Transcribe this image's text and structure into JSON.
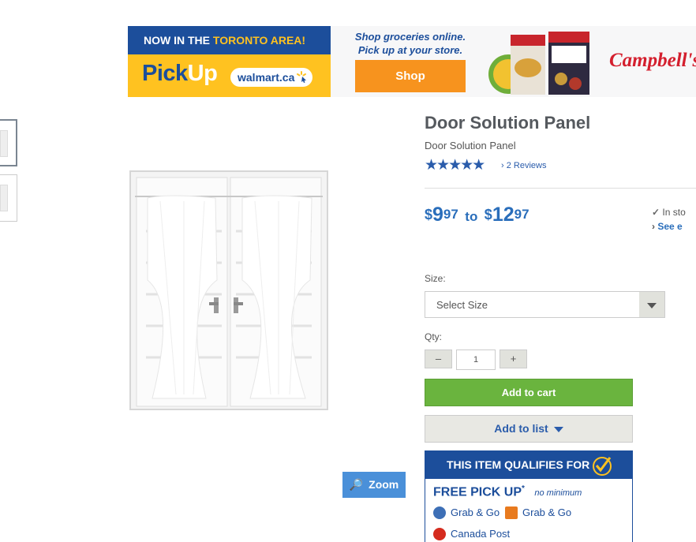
{
  "banner": {
    "headline_prefix": "NOW IN THE",
    "headline_highlight": "TORONTO AREA!",
    "pickup_part1": "Pick",
    "pickup_part2": "Up",
    "walmart_domain": "walmart.ca",
    "message_line1": "Shop groceries online.",
    "message_line2": "Pick up at your store.",
    "shop_button": "Shop",
    "brand": "Campbell's."
  },
  "product": {
    "title": "Door Solution Panel",
    "subtitle": "Door Solution Panel",
    "rating_stars": "★★★★★",
    "rating_value": 5,
    "reviews_link": "2 Reviews",
    "price": {
      "from_currency": "$",
      "from_dollars": "9",
      "from_cents": "97",
      "to_word": "to",
      "to_currency": "$",
      "to_dollars": "12",
      "to_cents": "97"
    },
    "stock_line1": "In sto",
    "stock_line2": "See e"
  },
  "options": {
    "size_label": "Size:",
    "size_placeholder": "Select Size",
    "qty_label": "Qty:",
    "qty_value": "1",
    "qty_minus": "–",
    "qty_plus": "+"
  },
  "actions": {
    "add_to_cart": "Add to cart",
    "add_to_list": "Add to list",
    "zoom": "Zoom"
  },
  "qualifies": {
    "header": "THIS ITEM QUALIFIES FOR",
    "free_pickup": "FREE PICK UP",
    "asterisk": "*",
    "no_minimum": "no minimum",
    "service1": "Grab & Go",
    "service2": "Grab & Go",
    "service3": "Canada Post"
  },
  "colors": {
    "brand_blue": "#1c4e9b",
    "yellow": "#ffc220",
    "price_blue": "#2a6ebb",
    "green": "#6ab43e",
    "orange": "#f7931e"
  }
}
